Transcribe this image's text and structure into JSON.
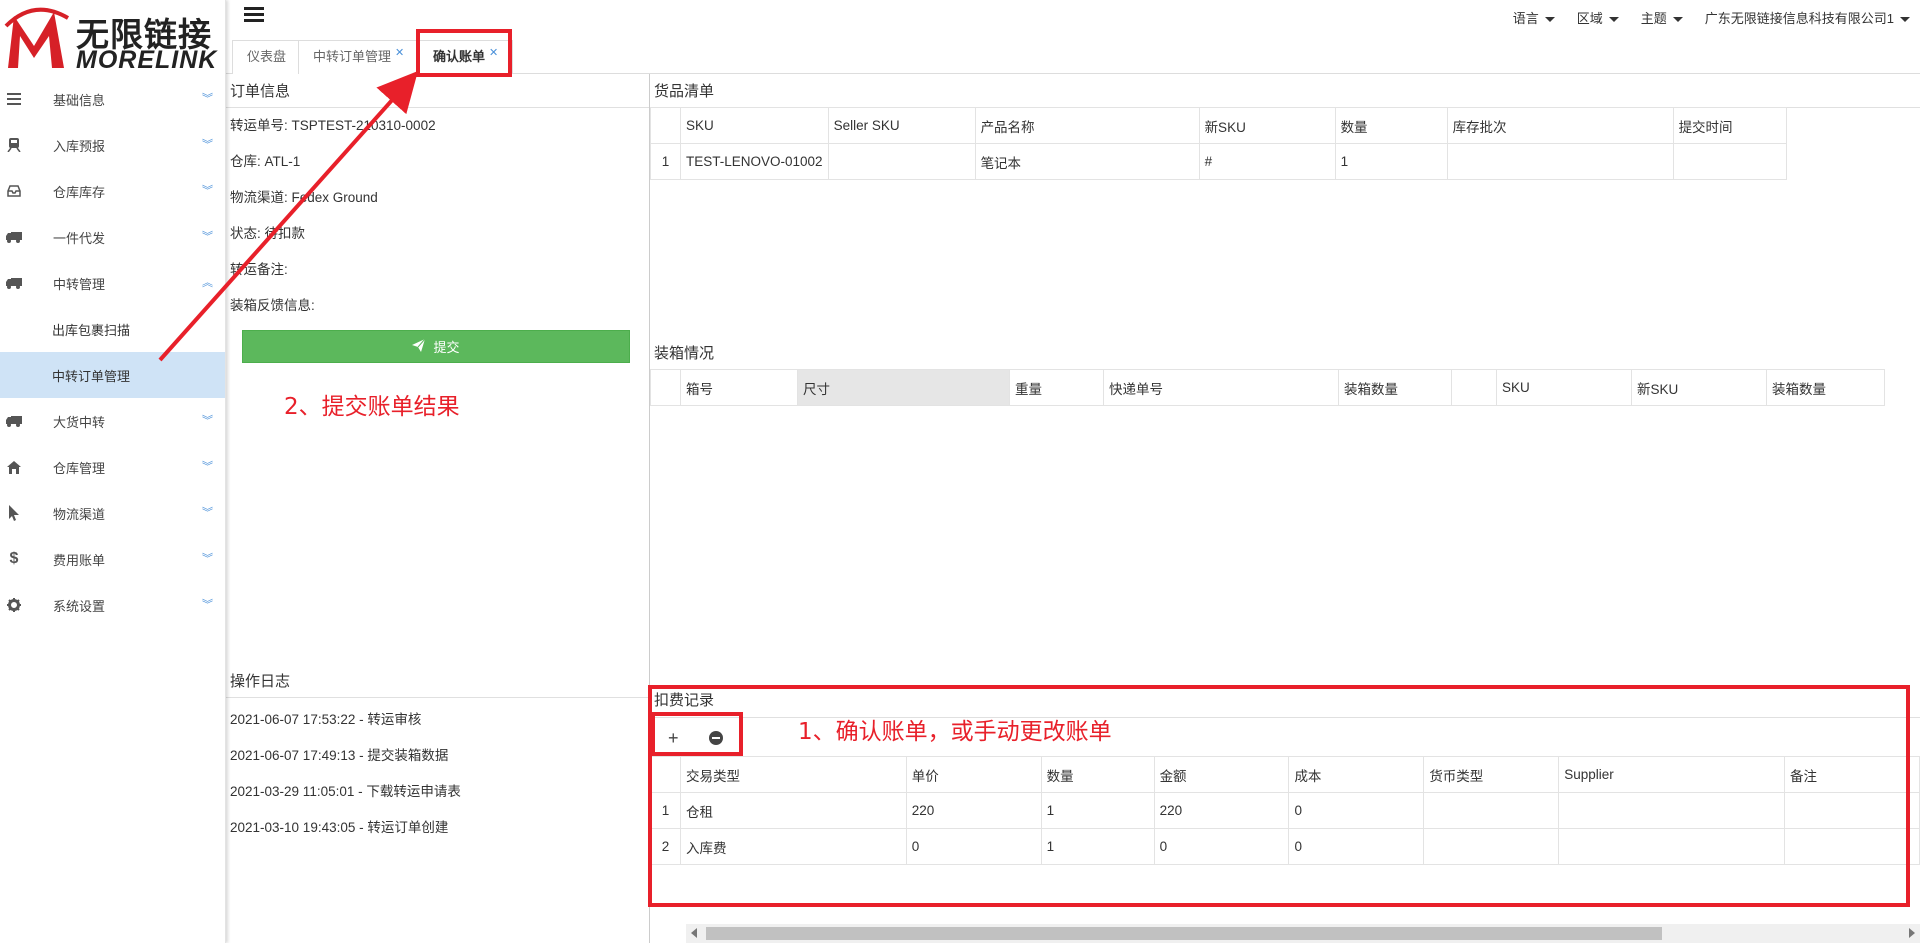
{
  "logo": {
    "cn": "无限链接",
    "en": "MORELINK"
  },
  "sidebar": {
    "items": [
      {
        "label": "基础信息",
        "icon": "list-icon"
      },
      {
        "label": "入库预报",
        "icon": "train-icon"
      },
      {
        "label": "仓库库存",
        "icon": "inbox-icon"
      },
      {
        "label": "一件代发",
        "icon": "truck-icon"
      },
      {
        "label": "中转管理",
        "icon": "truck-icon"
      }
    ],
    "sub_items": [
      {
        "label": "出库包裹扫描"
      },
      {
        "label": "中转订单管理"
      }
    ],
    "items_after": [
      {
        "label": "大货中转",
        "icon": "truck-icon"
      },
      {
        "label": "仓库管理",
        "icon": "home-icon"
      },
      {
        "label": "物流渠道",
        "icon": "pointer-icon"
      },
      {
        "label": "费用账单",
        "icon": "dollar-icon"
      },
      {
        "label": "系统设置",
        "icon": "gear-icon"
      }
    ]
  },
  "topbar": {
    "language": "语言",
    "region": "区域",
    "theme": "主题",
    "company": "广东无限链接信息科技有限公司1"
  },
  "tabs": [
    {
      "label": "仪表盘"
    },
    {
      "label": "中转订单管理"
    },
    {
      "label": "确认账单"
    }
  ],
  "order_info": {
    "title": "订单信息",
    "rows": [
      "转运单号: TSPTEST-210310-0002",
      "仓库: ATL-1",
      "物流渠道: Fedex Ground",
      "状态: 待扣款",
      "转运备注:",
      "装箱反馈信息:"
    ],
    "submit_label": "提交"
  },
  "op_log": {
    "title": "操作日志",
    "rows": [
      "2021-06-07 17:53:22 - 转运审核",
      "2021-06-07 17:49:13 - 提交装箱数据",
      "2021-03-29 11:05:01 - 下载转运申请表",
      "2021-03-10 19:43:05 - 转运订单创建"
    ]
  },
  "goods": {
    "title": "货品清单",
    "headers": [
      "SKU",
      "Seller SKU",
      "产品名称",
      "新SKU",
      "数量",
      "库存批次",
      "提交时间"
    ],
    "rows": [
      {
        "idx": "1",
        "cells": [
          "TEST-LENOVO-01002",
          "",
          "笔记本",
          "#",
          "1",
          "",
          ""
        ]
      }
    ]
  },
  "packing": {
    "title": "装箱情况",
    "headers": [
      "箱号",
      "尺寸",
      "重量",
      "快递单号",
      "装箱数量",
      "",
      "SKU",
      "新SKU",
      "装箱数量"
    ]
  },
  "fees": {
    "title": "扣费记录",
    "headers": [
      "交易类型",
      "单价",
      "数量",
      "金额",
      "成本",
      "货币类型",
      "Supplier",
      "备注"
    ],
    "rows": [
      {
        "idx": "1",
        "cells": [
          "仓租",
          "220",
          "1",
          "220",
          "0",
          "",
          "",
          ""
        ]
      },
      {
        "idx": "2",
        "cells": [
          "入库费",
          "0",
          "1",
          "0",
          "0",
          "",
          "",
          ""
        ]
      }
    ]
  },
  "annotations": {
    "step1": "1、确认账单，或手动更改账单",
    "step2": "2、提交账单结果",
    "color": "#e8202a"
  }
}
